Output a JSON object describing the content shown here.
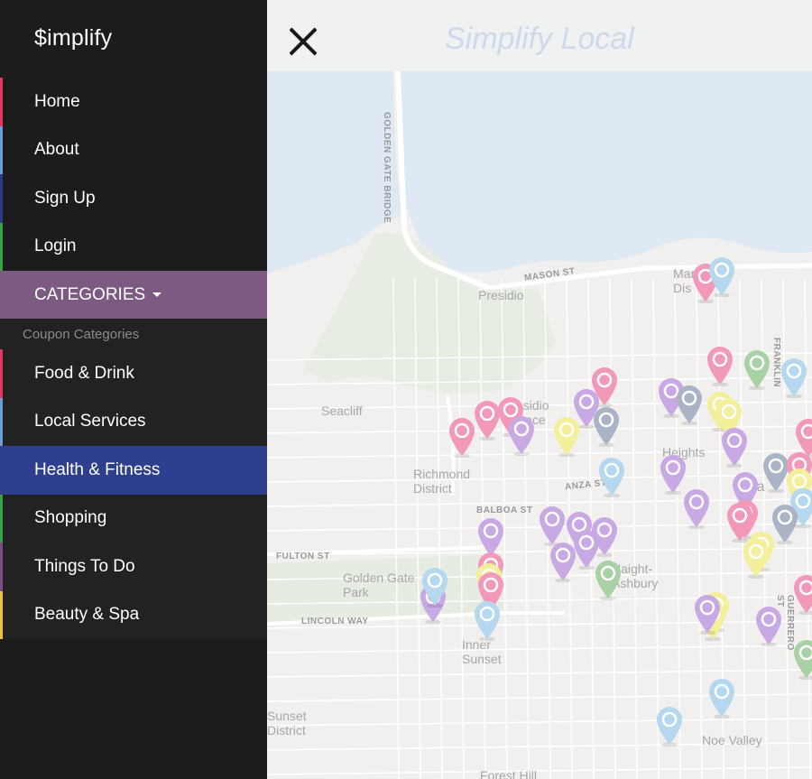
{
  "brand": "$implify",
  "nav": [
    {
      "label": "Home",
      "color": "#e8345e"
    },
    {
      "label": "About",
      "color": "#6aa0d8"
    },
    {
      "label": "Sign Up",
      "color": "#2e3a8a"
    },
    {
      "label": "Login",
      "color": "#3aa043"
    }
  ],
  "categories_label": "CATEGORIES",
  "dropdown": {
    "header": "Coupon Categories",
    "items": [
      {
        "label": "Food & Drink",
        "color": "#e8345e"
      },
      {
        "label": "Local Services",
        "color": "#6aa0d8"
      },
      {
        "label": "Health & Fitness",
        "color": "#2f3f8f"
      },
      {
        "label": "Shopping",
        "color": "#3aa043"
      },
      {
        "label": "Things To Do",
        "color": "#7b4a8a"
      },
      {
        "label": "Beauty & Spa",
        "color": "#e8c53a"
      }
    ]
  },
  "topbar": {
    "title": "Simplify Local"
  },
  "map": {
    "labels": [
      "Marina\nDis",
      "Presidio",
      "Presidio\nTerrace",
      "Seacliff",
      "Richmond\nDistrict",
      "Heights",
      "Golden Gate\nPark",
      "Haight-\nAshbury",
      "Inner\nSunset",
      "Sunset\nDistrict",
      "Noe Valley",
      "Forest Hill",
      "Sa"
    ],
    "streets": [
      "GOLDEN GATE BRIDGE",
      "MASON ST",
      "ANZA ST",
      "BALBOA ST",
      "FULTON ST",
      "LINCOLN WAY",
      "FRANKLIN",
      "GUERRERO ST"
    ],
    "pin_colors": {
      "pink": "#f298b8",
      "purple": "#c9a9e4",
      "blue": "#b5d8ef",
      "yellow": "#f3ef9a",
      "green": "#a8d2a6",
      "gray": "#aab4c6"
    }
  }
}
